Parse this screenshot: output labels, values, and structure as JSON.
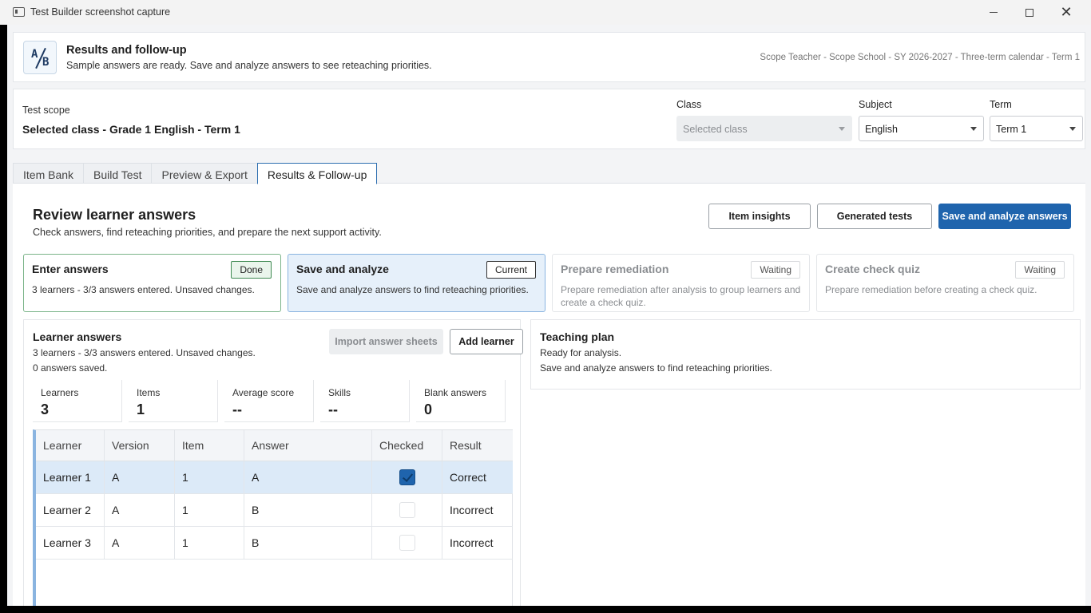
{
  "window": {
    "title": "Test Builder screenshot capture",
    "minimize": "minimize",
    "maximize": "maximize",
    "close": "✕"
  },
  "header": {
    "title": "Results and follow-up",
    "subtitle": "Sample answers are ready. Save and analyze answers to see reteaching priorities.",
    "meta": "Scope Teacher - Scope School - SY 2026-2027 - Three-term calendar - Term 1"
  },
  "scope": {
    "label": "Test scope",
    "value": "Selected class - Grade 1 English - Term 1",
    "class_label": "Class",
    "class_value": "Selected class",
    "subject_label": "Subject",
    "subject_value": "English",
    "term_label": "Term",
    "term_value": "Term 1"
  },
  "tabs": [
    "Item Bank",
    "Build Test",
    "Preview & Export",
    "Results & Follow-up"
  ],
  "review": {
    "title": "Review learner answers",
    "subtitle": "Check answers, find reteaching priorities, and prepare the next support activity.",
    "btn_insights": "Item insights",
    "btn_generated": "Generated tests",
    "btn_save": "Save and analyze answers"
  },
  "steps": [
    {
      "title": "Enter answers",
      "badge": "Done",
      "desc": "3 learners - 3/3 answers entered. Unsaved changes."
    },
    {
      "title": "Save and analyze",
      "badge": "Current",
      "desc": "Save and analyze answers to find reteaching priorities."
    },
    {
      "title": "Prepare remediation",
      "badge": "Waiting",
      "desc": "Prepare remediation after analysis to group learners and create a check quiz."
    },
    {
      "title": "Create check quiz",
      "badge": "Waiting",
      "desc": "Prepare remediation before creating a check quiz."
    }
  ],
  "learner_answers": {
    "title": "Learner answers",
    "line1": "3 learners - 3/3 answers entered. Unsaved changes.",
    "line2": "0 answers saved.",
    "btn_import": "Import answer sheets",
    "btn_add": "Add learner",
    "stats": [
      {
        "label": "Learners",
        "value": "3"
      },
      {
        "label": "Items",
        "value": "1"
      },
      {
        "label": "Average score",
        "value": "--"
      },
      {
        "label": "Skills",
        "value": "--"
      },
      {
        "label": "Blank answers",
        "value": "0"
      }
    ],
    "columns": [
      "Learner",
      "Version",
      "Item",
      "Answer",
      "Checked",
      "Result"
    ],
    "rows": [
      {
        "learner": "Learner 1",
        "version": "A",
        "item": "1",
        "answer": "A",
        "checked": true,
        "result": "Correct"
      },
      {
        "learner": "Learner 2",
        "version": "A",
        "item": "1",
        "answer": "B",
        "checked": false,
        "result": "Incorrect"
      },
      {
        "learner": "Learner 3",
        "version": "A",
        "item": "1",
        "answer": "B",
        "checked": false,
        "result": "Incorrect"
      }
    ]
  },
  "teaching_plan": {
    "title": "Teaching plan",
    "line1": "Ready for analysis.",
    "line2": "Save and analyze answers to find reteaching priorities."
  }
}
